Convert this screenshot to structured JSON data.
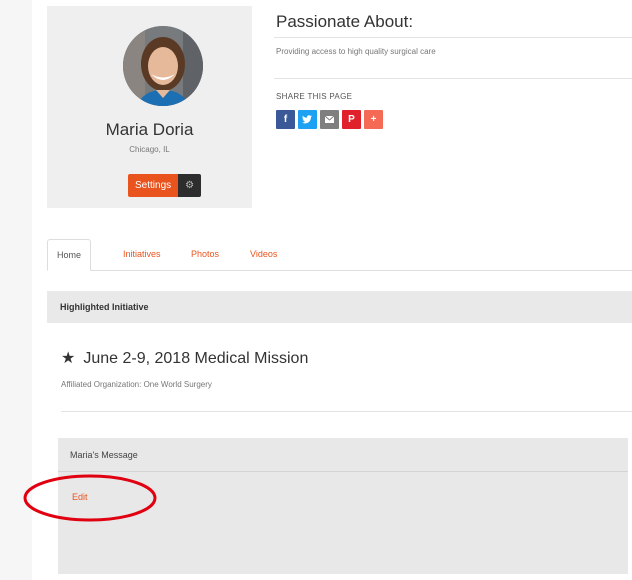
{
  "profile": {
    "name": "Maria Doria",
    "location": "Chicago, IL",
    "settings_label": "Settings",
    "gear_glyph": "⚙"
  },
  "about": {
    "heading": "Passionate About:",
    "text": "Providing access to high quality surgical care",
    "share_label": "SHARE THIS PAGE",
    "share_buttons": [
      {
        "icon": "facebook-icon",
        "glyph": "f",
        "color": "#3b5998"
      },
      {
        "icon": "twitter-icon",
        "glyph": "🐦",
        "color": "#1da1f2"
      },
      {
        "icon": "email-icon",
        "glyph": "✉",
        "color": "#7f7f7f"
      },
      {
        "icon": "pinterest-icon",
        "glyph": "P",
        "color": "#e0202a"
      },
      {
        "icon": "more-share-icon",
        "glyph": "+",
        "color": "#f46a54"
      }
    ]
  },
  "tabs": [
    {
      "label": "Home",
      "active": true
    },
    {
      "label": "Initiatives",
      "active": false
    },
    {
      "label": "Photos",
      "active": false
    },
    {
      "label": "Videos",
      "active": false
    }
  ],
  "highlighted": {
    "section_title": "Highlighted Initiative",
    "star_glyph": "★",
    "initiative_title": "June 2-9, 2018 Medical Mission",
    "affiliated": "Affiliated Organization: One World Surgery"
  },
  "message": {
    "title": "Maria's Message",
    "edit_label": "Edit"
  },
  "colors": {
    "accent": "#e9541e",
    "annotation": "#e0000f"
  }
}
